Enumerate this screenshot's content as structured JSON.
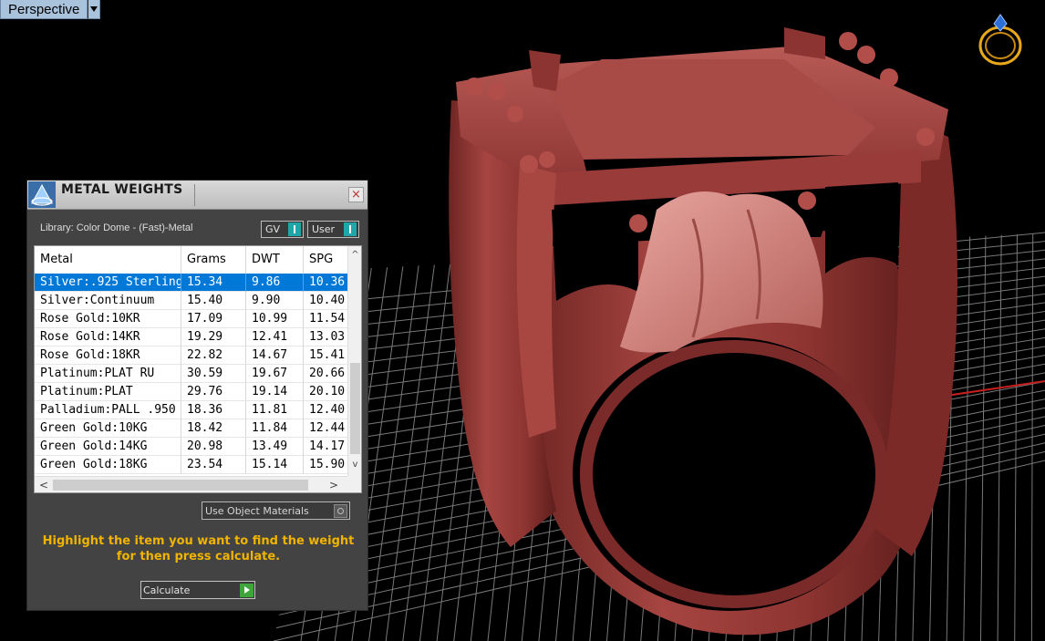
{
  "viewport": {
    "label": "Perspective"
  },
  "panel": {
    "title": "METAL WEIGHTS",
    "close_glyph": "×",
    "library_label": "Library: Color Dome - (Fast)-Metal",
    "toggle_gv": "GV",
    "toggle_user": "User",
    "columns": [
      "Metal",
      "Grams",
      "DWT",
      "SPG"
    ],
    "rows": [
      {
        "metal": "Silver:.925 Sterling",
        "grams": "15.34",
        "dwt": "9.86",
        "spg": "10.36"
      },
      {
        "metal": "Silver:Continuum",
        "grams": "15.40",
        "dwt": "9.90",
        "spg": "10.40"
      },
      {
        "metal": "Rose Gold:10KR",
        "grams": "17.09",
        "dwt": "10.99",
        "spg": "11.54"
      },
      {
        "metal": "Rose Gold:14KR",
        "grams": "19.29",
        "dwt": "12.41",
        "spg": "13.03"
      },
      {
        "metal": "Rose Gold:18KR",
        "grams": "22.82",
        "dwt": "14.67",
        "spg": "15.41"
      },
      {
        "metal": "Platinum:PLAT RU",
        "grams": "30.59",
        "dwt": "19.67",
        "spg": "20.66"
      },
      {
        "metal": "Platinum:PLAT",
        "grams": "29.76",
        "dwt": "19.14",
        "spg": "20.10"
      },
      {
        "metal": "Palladium:PALL .950",
        "grams": "18.36",
        "dwt": "11.81",
        "spg": "12.40"
      },
      {
        "metal": "Green Gold:10KG",
        "grams": "18.42",
        "dwt": "11.84",
        "spg": "12.44"
      },
      {
        "metal": "Green Gold:14KG",
        "grams": "20.98",
        "dwt": "13.49",
        "spg": "14.17"
      },
      {
        "metal": "Green Gold:18KG",
        "grams": "23.54",
        "dwt": "15.14",
        "spg": "15.90"
      }
    ],
    "selected_row": 0,
    "use_object_materials": "Use Object Materials",
    "hint_line1": "Highlight the item you want to find the weight",
    "hint_line2": "for then press calculate.",
    "calculate_label": "Calculate"
  },
  "colors": {
    "ring": "#9b3e3b",
    "grid": "#9a9a9a",
    "selection": "#0078d7",
    "hint_text": "#f0b400",
    "axis_x": "#c81e1e",
    "axis_y": "#2fb6c8"
  },
  "icons": {
    "scroll_up": "^",
    "scroll_down": "v",
    "scroll_left": "<",
    "scroll_right": ">"
  }
}
